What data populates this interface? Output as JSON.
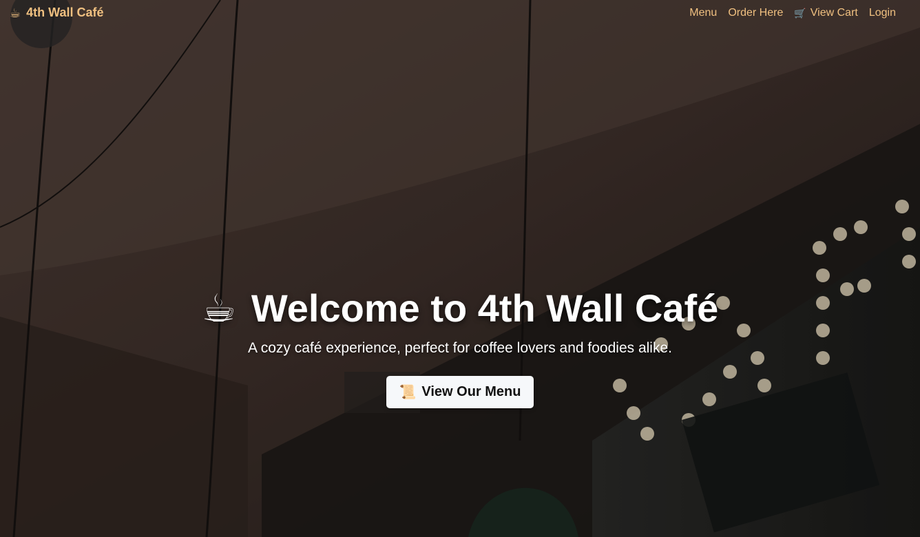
{
  "navbar": {
    "brand_icon": "coffee-cup-icon",
    "brand_name": "4th Wall Café",
    "links": [
      {
        "label": "Menu"
      },
      {
        "label": "Order Here"
      },
      {
        "label": "View Cart",
        "icon": "cart-icon"
      },
      {
        "label": "Login"
      }
    ]
  },
  "hero": {
    "title_icon": "coffee-cup-icon",
    "title": "Welcome to 4th Wall Café",
    "subtitle": "A cozy café experience, perfect for coffee lovers and foodies alike.",
    "cta_icon": "scroll-icon",
    "cta_label": "View Our Menu"
  },
  "colors": {
    "nav_accent": "#f0c080",
    "title": "#ffffff",
    "button_bg": "#f6f8fa"
  }
}
